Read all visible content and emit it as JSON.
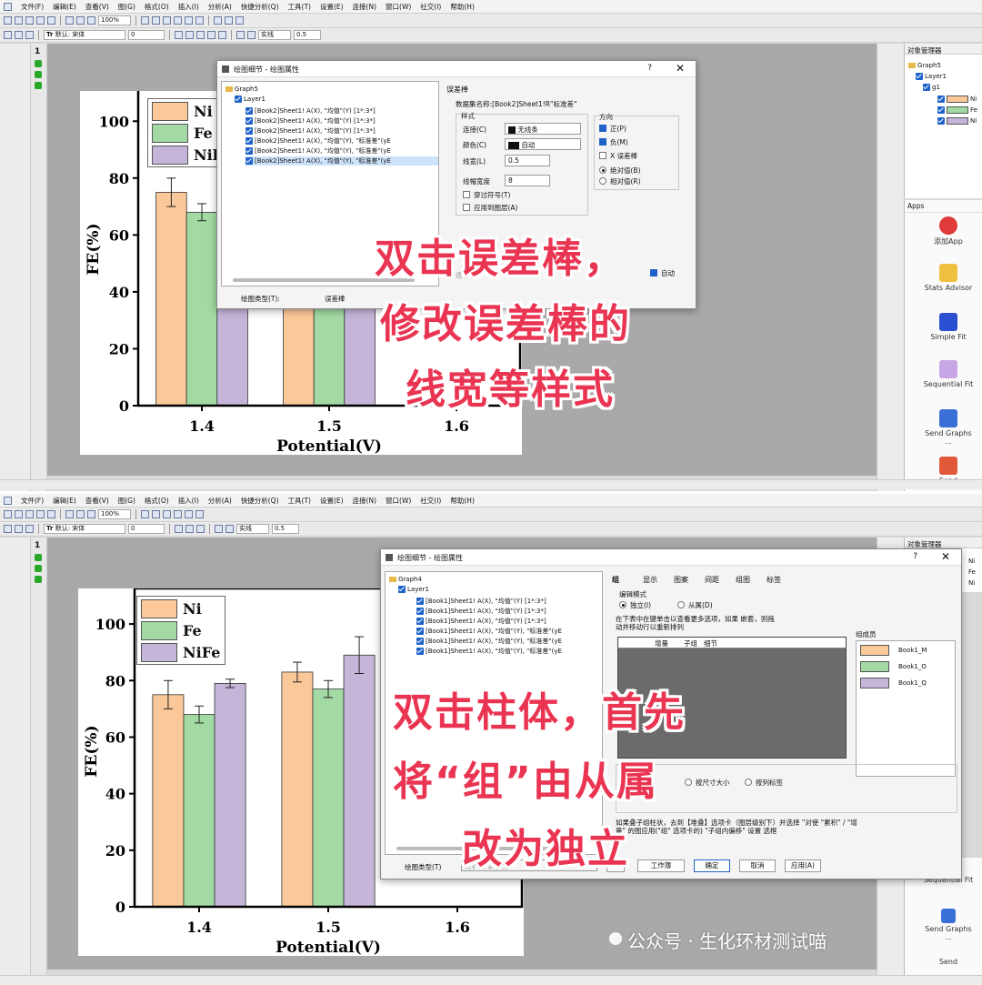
{
  "menu": [
    "文件(F)",
    "编辑(E)",
    "查看(V)",
    "图(G)",
    "格式(O)",
    "插入(I)",
    "分析(A)",
    "快捷分析(Q)",
    "工具(T)",
    "设置(E)",
    "连接(N)",
    "窗口(W)",
    "社交(I)",
    "帮助(H)"
  ],
  "toolbar": {
    "zoom": "100%",
    "font_prefix": "Tr",
    "font_name": "默认: 宋体",
    "font_size": "0",
    "line_label": "实线",
    "line_width": "0.5"
  },
  "colors": {
    "ni": "#fbc899",
    "fe": "#a3d9a3",
    "nife": "#c5b6d9",
    "overlay_text": "#ea3552",
    "accent": "#1f62c9"
  },
  "left_tool_labels": [
    "项目管理器",
    "消息日志",
    "提示日志"
  ],
  "page_number": "1",
  "legend": [
    "Ni",
    "Fe",
    "NiFe"
  ],
  "chart_data": [
    {
      "type": "bar",
      "title": "",
      "xlabel": "Potential(V)",
      "ylabel": "FE(%)",
      "categories": [
        "1.4",
        "1.5",
        "1.6"
      ],
      "ylim": [
        0,
        110
      ],
      "yticks": [
        "0",
        "20",
        "40",
        "60",
        "80",
        "100"
      ],
      "series": [
        {
          "name": "Ni",
          "values": [
            75,
            83,
            null
          ],
          "errors": [
            5,
            3.5,
            null
          ]
        },
        {
          "name": "Fe",
          "values": [
            68,
            77,
            null
          ],
          "errors": [
            3,
            3,
            null
          ]
        },
        {
          "name": "NiFe",
          "values": [
            79,
            89,
            null
          ],
          "errors": [
            1.5,
            6.5,
            null
          ]
        }
      ]
    }
  ],
  "top": {
    "legend_visible": [
      "Ni",
      "Fe",
      "Nil"
    ],
    "object_manager": {
      "title": "对象管理器",
      "graph": "Graph5",
      "layer": "Layer1",
      "group": "g1",
      "items": [
        "Ni",
        "Fe",
        "Ni"
      ]
    },
    "apps": {
      "title": "Apps",
      "side_label": "项目管理器",
      "items": [
        "添加App",
        "Stats Advisor",
        "Simple Fit",
        "Sequential Fit",
        "Send Graphs ...",
        "Send"
      ]
    },
    "dialog": {
      "title": "绘图细节 - 绘图属性",
      "help": "?",
      "close": "✕",
      "tree": [
        "Graph5",
        "Layer1",
        "[Book2]Sheet1! A(X), \"均值\"(Y) [1*:3*]",
        "[Book2]Sheet1! A(X), \"均值\"(Y) [1*:3*]",
        "[Book2]Sheet1! A(X), \"均值\"(Y) [1*:3*]",
        "[Book2]Sheet1! A(X), \"均值\"(Y), \"标准差\"(yE",
        "[Book2]Sheet1! A(X), \"均值\"(Y), \"标准差\"(yE",
        "[Book2]Sheet1! A(X), \"均值\"(Y), \"标准差\"(yE"
      ],
      "tab": "误差棒",
      "dataset": "数据集名称:[Book2]Sheet1!R\"标准差\"",
      "style_group": "样式",
      "connect_label": "连接(C)",
      "connect_value": "无线条",
      "color_label": "颜色(C)",
      "color_value": "自动",
      "linewidth_label": "线宽(L)",
      "linewidth_value": "0.5",
      "capwidth_label": "线帽宽度",
      "capwidth_value": "8",
      "through_symbol": "穿过符号(T)",
      "apply_layer": "应用到图层(A)",
      "direction_group": "方向",
      "plus": "正(P)",
      "minus": "负(M)",
      "x_error": "X 误差棒",
      "absolute": "绝对值(B)",
      "relative": "相对值(R)",
      "auto": "自动",
      "transparency": "透明(T):",
      "plot_type_label": "绘图类型(T):",
      "plot_type_value": "误差棒"
    },
    "overlay": [
      "双击误差棒，",
      "修改误差棒的",
      "线宽等样式"
    ]
  },
  "bottom": {
    "legend_visible": [
      "Ni",
      "Fe",
      "NiFe"
    ],
    "object_manager": {
      "title": "对象管理器",
      "items": [
        "Ni",
        "Fe",
        "Ni"
      ]
    },
    "apps": {
      "items": [
        "Sequential Fit",
        "Send Graphs ...",
        "Send"
      ]
    },
    "dialog": {
      "title": "绘图细节 - 绘图属性",
      "help": "?",
      "close": "✕",
      "tree": [
        "Graph4",
        "Layer1",
        "[Book1]Sheet1! A(X), \"均值\"(Y) [1*:3*]",
        "[Book1]Sheet1! A(X), \"均值\"(Y) [1*:3*]",
        "[Book1]Sheet1! A(X), \"均值\"(Y) [1*:3*]",
        "[Book1]Sheet1! A(X), \"均值\"(Y), \"标准差\"(yE",
        "[Book1]Sheet1! A(X), \"均值\"(Y), \"标准差\"(yE",
        "[Book1]Sheet1! A(X), \"均值\"(Y), \"标准差\"(yE"
      ],
      "tabs": [
        "组",
        "显示",
        "图案",
        "间距",
        "组图",
        "标签"
      ],
      "edit_mode": "编辑模式",
      "independent": "独立(I)",
      "dependent": "从属(D)",
      "hint": "在下表中在键单击以查看更多选项，如果 嵌套，则拖动并移动行以重新排列",
      "table_cols": [
        "增量",
        "子组",
        "细节"
      ],
      "members_label": "组成员",
      "members": [
        "Book1_M",
        "Book1_O",
        "Book1_Q"
      ],
      "order_first": "先",
      "order_size": "按尺寸大小",
      "order_label": "按列标签",
      "note": "如果叠子组柱状，去到【堆叠】选项卡（图层级别下）并选择 \"对使 \"累积\" / \"增量\" 的图应用(\"组\" 选项卡的) \"子组内偏移\" 设置 选框",
      "plot_type_label": "绘图类型(T)",
      "plot_type_value": "柱状图/条形图",
      "expand": ">>",
      "workbook": "工作簿",
      "ok": "确定",
      "cancel": "取消",
      "apply": "应用(A)"
    },
    "overlay": [
      "双击柱体，首先",
      "将“组”由从属",
      "改为独立"
    ],
    "watermark": "公众号 · 生化环材测试喵"
  }
}
